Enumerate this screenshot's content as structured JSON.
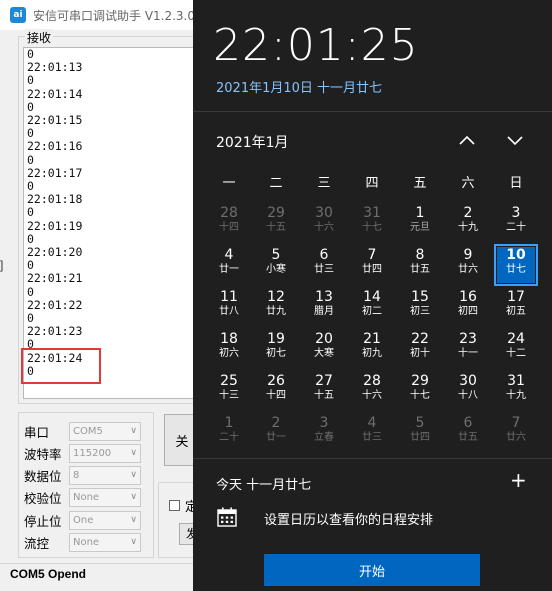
{
  "app": {
    "title": "安信可串口调试助手 V1.2.3.0",
    "icon_text": "ai",
    "recv_legend": "接收",
    "log_lines": [
      "0",
      "22:01:13",
      "0",
      "22:01:14",
      "0",
      "22:01:15",
      "0",
      "22:01:16",
      "0",
      "22:01:17",
      "0",
      "22:01:18",
      "0",
      "22:01:19",
      "0",
      "22:01:20",
      "0",
      "22:01:21",
      "0",
      "22:01:22",
      "0",
      "22:01:23",
      "0",
      "22:01:24",
      "0"
    ],
    "left_edge_glyph": "]",
    "settings": [
      {
        "label": "串口",
        "value": "COM5"
      },
      {
        "label": "波特率",
        "value": "115200"
      },
      {
        "label": "数据位",
        "value": "8"
      },
      {
        "label": "校验位",
        "value": "None"
      },
      {
        "label": "停止位",
        "value": "One"
      },
      {
        "label": "流控",
        "value": "None"
      }
    ],
    "open_button": "关",
    "option_label": "定",
    "option_button": "发",
    "status": "COM5 Opend"
  },
  "flyout": {
    "time": "22:01:25",
    "date": "2021年1月10日 十一月廿七",
    "month_label": "2021年1月",
    "weekdays": [
      "一",
      "二",
      "三",
      "四",
      "五",
      "六",
      "日"
    ],
    "days": [
      {
        "n": "28",
        "l": "十四",
        "s": "dim"
      },
      {
        "n": "29",
        "l": "十五",
        "s": "dim"
      },
      {
        "n": "30",
        "l": "十六",
        "s": "dim"
      },
      {
        "n": "31",
        "l": "十七",
        "s": "dim"
      },
      {
        "n": "1",
        "l": "元旦",
        "s": "cur"
      },
      {
        "n": "2",
        "l": "十九",
        "s": "cur"
      },
      {
        "n": "3",
        "l": "二十",
        "s": "cur"
      },
      {
        "n": "4",
        "l": "廿一",
        "s": "cur"
      },
      {
        "n": "5",
        "l": "小寒",
        "s": "cur"
      },
      {
        "n": "6",
        "l": "廿三",
        "s": "cur"
      },
      {
        "n": "7",
        "l": "廿四",
        "s": "cur"
      },
      {
        "n": "8",
        "l": "廿五",
        "s": "cur"
      },
      {
        "n": "9",
        "l": "廿六",
        "s": "cur"
      },
      {
        "n": "10",
        "l": "廿七",
        "s": "today"
      },
      {
        "n": "11",
        "l": "廿八",
        "s": "cur"
      },
      {
        "n": "12",
        "l": "廿九",
        "s": "cur"
      },
      {
        "n": "13",
        "l": "腊月",
        "s": "cur"
      },
      {
        "n": "14",
        "l": "初二",
        "s": "cur"
      },
      {
        "n": "15",
        "l": "初三",
        "s": "cur"
      },
      {
        "n": "16",
        "l": "初四",
        "s": "cur"
      },
      {
        "n": "17",
        "l": "初五",
        "s": "cur"
      },
      {
        "n": "18",
        "l": "初六",
        "s": "cur"
      },
      {
        "n": "19",
        "l": "初七",
        "s": "cur"
      },
      {
        "n": "20",
        "l": "大寒",
        "s": "cur"
      },
      {
        "n": "21",
        "l": "初九",
        "s": "cur"
      },
      {
        "n": "22",
        "l": "初十",
        "s": "cur"
      },
      {
        "n": "23",
        "l": "十一",
        "s": "cur"
      },
      {
        "n": "24",
        "l": "十二",
        "s": "cur"
      },
      {
        "n": "25",
        "l": "十三",
        "s": "cur"
      },
      {
        "n": "26",
        "l": "十四",
        "s": "cur"
      },
      {
        "n": "27",
        "l": "十五",
        "s": "cur"
      },
      {
        "n": "28",
        "l": "十六",
        "s": "cur"
      },
      {
        "n": "29",
        "l": "十七",
        "s": "cur"
      },
      {
        "n": "30",
        "l": "十八",
        "s": "cur"
      },
      {
        "n": "31",
        "l": "十九",
        "s": "cur"
      },
      {
        "n": "1",
        "l": "二十",
        "s": "dim"
      },
      {
        "n": "2",
        "l": "廿一",
        "s": "dim"
      },
      {
        "n": "3",
        "l": "立春",
        "s": "dim"
      },
      {
        "n": "4",
        "l": "廿三",
        "s": "dim"
      },
      {
        "n": "5",
        "l": "廿四",
        "s": "dim"
      },
      {
        "n": "6",
        "l": "廿五",
        "s": "dim"
      },
      {
        "n": "7",
        "l": "廿六",
        "s": "dim"
      }
    ],
    "agenda_today": "今天 十一月廿七",
    "add_symbol": "+",
    "agenda_hint": "设置日历以查看你的日程安排",
    "start_button": "开始",
    "colors": {
      "accent": "#0067c0",
      "date_text": "#85c3ff",
      "panel_bg": "#1f1f1f",
      "highlight": "#e53935"
    }
  }
}
